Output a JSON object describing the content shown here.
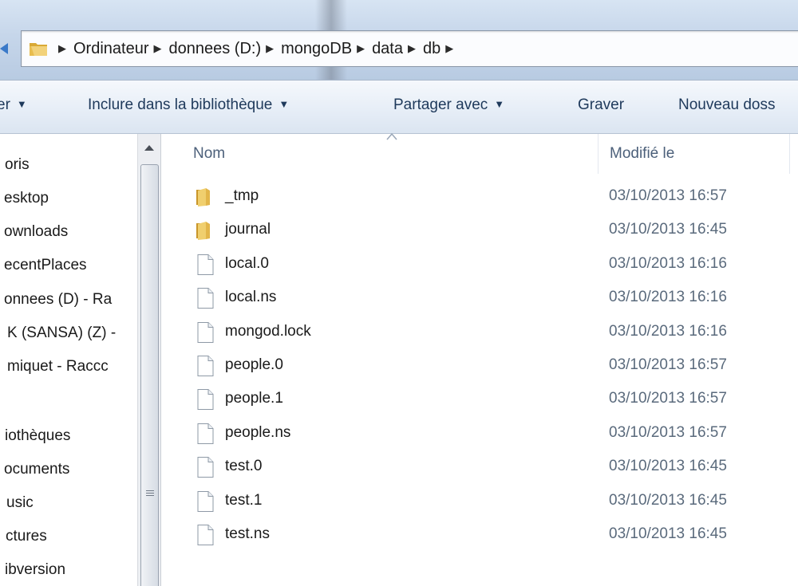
{
  "address_bar": {
    "breadcrumbs": [
      "Ordinateur",
      "donnees (D:)",
      "mongoDB",
      "data",
      "db"
    ]
  },
  "toolbar": {
    "organize_partial": "er",
    "include_library": "Inclure dans la bibliothèque",
    "share_with": "Partager avec",
    "burn": "Graver",
    "new_folder_partial": "Nouveau doss"
  },
  "navigation": {
    "items": [
      {
        "label": "oris"
      },
      {
        "label": "esktop"
      },
      {
        "label": "ownloads"
      },
      {
        "label": "ecentPlaces"
      },
      {
        "label": "onnees (D) - Ra"
      },
      {
        "label": "K (SANSA) (Z) -"
      },
      {
        "label": "miquet - Raccc"
      },
      {
        "label": ""
      },
      {
        "label": "iothèques"
      },
      {
        "label": "ocuments"
      },
      {
        "label": "usic"
      },
      {
        "label": "ctures"
      },
      {
        "label": "ibversion"
      }
    ]
  },
  "file_list": {
    "columns": {
      "name": "Nom",
      "modified": "Modifié le"
    },
    "sorted_by": "name",
    "rows": [
      {
        "name": "_tmp",
        "modified": "03/10/2013 16:57",
        "type": "folder"
      },
      {
        "name": "journal",
        "modified": "03/10/2013 16:45",
        "type": "folder"
      },
      {
        "name": "local.0",
        "modified": "03/10/2013 16:16",
        "type": "file"
      },
      {
        "name": "local.ns",
        "modified": "03/10/2013 16:16",
        "type": "file"
      },
      {
        "name": "mongod.lock",
        "modified": "03/10/2013 16:16",
        "type": "file"
      },
      {
        "name": "people.0",
        "modified": "03/10/2013 16:57",
        "type": "file"
      },
      {
        "name": "people.1",
        "modified": "03/10/2013 16:57",
        "type": "file"
      },
      {
        "name": "people.ns",
        "modified": "03/10/2013 16:57",
        "type": "file"
      },
      {
        "name": "test.0",
        "modified": "03/10/2013 16:45",
        "type": "file"
      },
      {
        "name": "test.1",
        "modified": "03/10/2013 16:45",
        "type": "file"
      },
      {
        "name": "test.ns",
        "modified": "03/10/2013 16:45",
        "type": "file"
      }
    ]
  },
  "colors": {
    "folder": "#e9c35a",
    "toolbar_text": "#1e395b",
    "date_text": "#5a6a7c",
    "header_text": "#4c607a"
  }
}
